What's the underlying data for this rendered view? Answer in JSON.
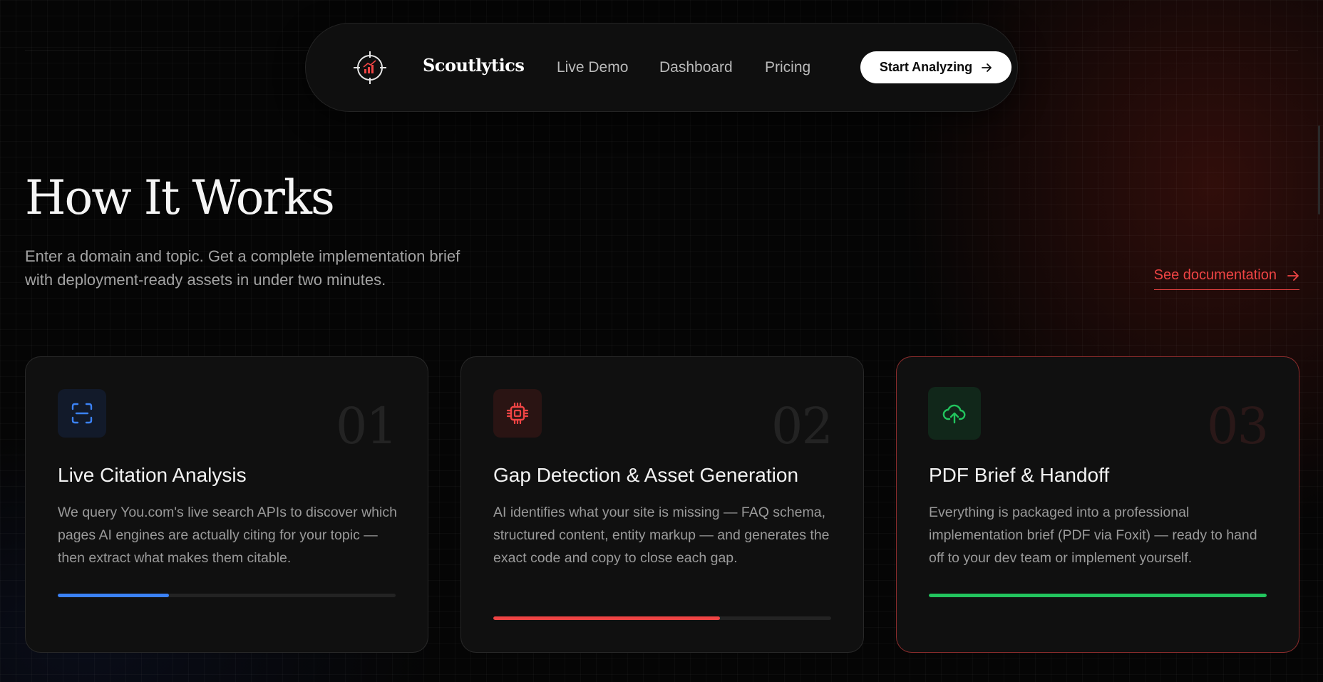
{
  "nav": {
    "brand": "Scoutlytics",
    "links": [
      "Live Demo",
      "Dashboard",
      "Pricing"
    ],
    "cta_label": "Start Analyzing"
  },
  "header": {
    "title": "How It Works",
    "subtitle": "Enter a domain and topic. Get a complete implementation brief with deployment-ready assets in under two minutes.",
    "doc_link": "See documentation"
  },
  "steps": [
    {
      "number": "01",
      "title": "Live Citation Analysis",
      "description": "We query You.com's live search APIs to discover which pages AI engines are actually citing for your topic — then extract what makes them citable.",
      "icon": "scan-icon",
      "accent": "#3b82f6",
      "progress": 0.33
    },
    {
      "number": "02",
      "title": "Gap Detection & Asset Generation",
      "description": "AI identifies what your site is missing — FAQ schema, structured content, entity markup — and generates the exact code and copy to close each gap.",
      "icon": "cpu-icon",
      "accent": "#ef4444",
      "progress": 0.67
    },
    {
      "number": "03",
      "title": "PDF Brief & Handoff",
      "description": "Everything is packaged into a professional implementation brief (PDF via Foxit) — ready to hand off to your dev team or implement yourself.",
      "icon": "cloud-upload-icon",
      "accent": "#22c55e",
      "progress": 1.0
    }
  ]
}
